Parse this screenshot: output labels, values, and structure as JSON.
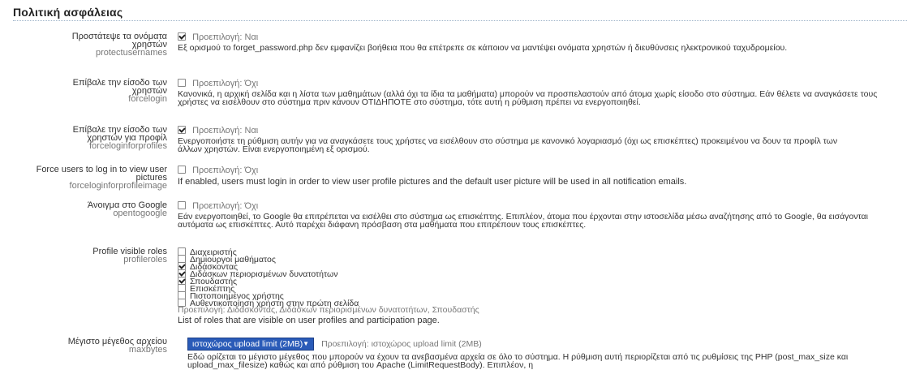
{
  "page": {
    "title": "Πολιτική ασφάλειας"
  },
  "settings": [
    {
      "label": "Προστάτεψε τα ονόματα χρηστών",
      "name": "protectusernames",
      "checked": true,
      "default": "Προεπιλογή: Ναι",
      "description": "Εξ ορισμού το forget_password.php δεν εμφανίζει βοήθεια που θα επέτρεπε σε κάποιον να μαντέψει ονόματα χρηστών ή διευθύνσεις ηλεκτρονικού ταχυδρομείου."
    },
    {
      "label": "Επίβαλε την είσοδο των χρηστών",
      "name": "forcelogin",
      "checked": false,
      "default": "Προεπιλογή: Όχι",
      "description": "Κανονικά, η αρχική σελίδα και η λίστα των μαθημάτων (αλλά όχι τα ίδια τα μαθήματα) μπορούν να προσπελαστούν από άτομα χωρίς είσοδο στο σύστημα. Εάν θέλετε να αναγκάσετε τους χρήστες να εισέλθουν στο σύστημα πριν κάνουν ΟΤΙΔΗΠΟΤΕ στο σύστημα, τότε αυτή η ρύθμιση πρέπει να ενεργοποιηθεί."
    },
    {
      "label": "Επίβαλε την είσοδο των χρηστών για προφίλ",
      "name": "forceloginforprofiles",
      "checked": true,
      "default": "Προεπιλογή: Ναι",
      "description": "Ενεργοποιήστε τη ρύθμιση αυτήν για να αναγκάσετε τους χρήστες να εισέλθουν στο σύστημα με κανονικό λογαριασμό (όχι ως επισκέπτες) προκειμένου να δουν τα προφίλ των άλλων χρηστών. Είναι ενεργοποιημένη εξ ορισμού."
    },
    {
      "label": "Force users to log in to view user pictures",
      "name": "forceloginforprofileimage",
      "checked": false,
      "default": "Προεπιλογή: Όχι",
      "description": "If enabled, users must login in order to view user profile pictures and the default user picture will be used in all notification emails."
    },
    {
      "label": "Άνοιγμα στο Google",
      "name": "opentogoogle",
      "checked": false,
      "default": "Προεπιλογή: Όχι",
      "description": "Εάν ενεργοποιηθεί, το Google θα επιτρέπεται να εισέλθει στο σύστημα ως επισκέπτης. Επιπλέον, άτομα που έρχονται στην ιστοσελίδα μέσω αναζήτησης από το Google, θα εισάγονται αυτόματα ως επισκέπτες. Αυτό παρέχει διάφανη πρόσβαση στα μαθήματα που επιτρέπουν τους επισκέπτες."
    }
  ],
  "profileroles": {
    "label": "Profile visible roles",
    "name": "profileroles",
    "roles": [
      {
        "label": "Διαχειριστής",
        "checked": false
      },
      {
        "label": "Δημιουργοί μαθήματος",
        "checked": false
      },
      {
        "label": "Διδάσκοντας",
        "checked": true
      },
      {
        "label": "Διδάσκων περιορισμένων δυνατοτήτων",
        "checked": true
      },
      {
        "label": "Σπουδαστής",
        "checked": true
      },
      {
        "label": "Επισκέπτης",
        "checked": false
      },
      {
        "label": "Πιστοποιημένος χρήστης",
        "checked": false
      },
      {
        "label": "Αυθεντικοποίηση χρήστη στην πρώτη σελίδα",
        "checked": false
      }
    ],
    "default": "Προεπιλογή: Διδάσκοντας, Διδάσκων περιορισμένων δυνατοτήτων, Σπουδαστής",
    "description": "List of roles that are visible on user profiles and participation page."
  },
  "maxbytes": {
    "label": "Μέγιστο μέγεθος αρχείου",
    "name": "maxbytes",
    "selected": "ιστοχώρος upload limit (2MB)",
    "default": "Προεπιλογή: ιστοχώρος upload limit (2MB)",
    "description": "Εδώ ορίζεται το μέγιστο μέγεθος που μπορούν να έχουν τα ανεβασμένα αρχεία σε όλο το σύστημα. Η ρύθμιση αυτή περιορίζεται από τις ρυθμίσεις της PHP (post_max_size και upload_max_filesize) καθώς και από ρύθμιση του Apache (LimitRequestBody). Επιπλέον, η"
  },
  "colors": {
    "select_bg": "#2a5bb8",
    "rule": "#9db3c8"
  }
}
